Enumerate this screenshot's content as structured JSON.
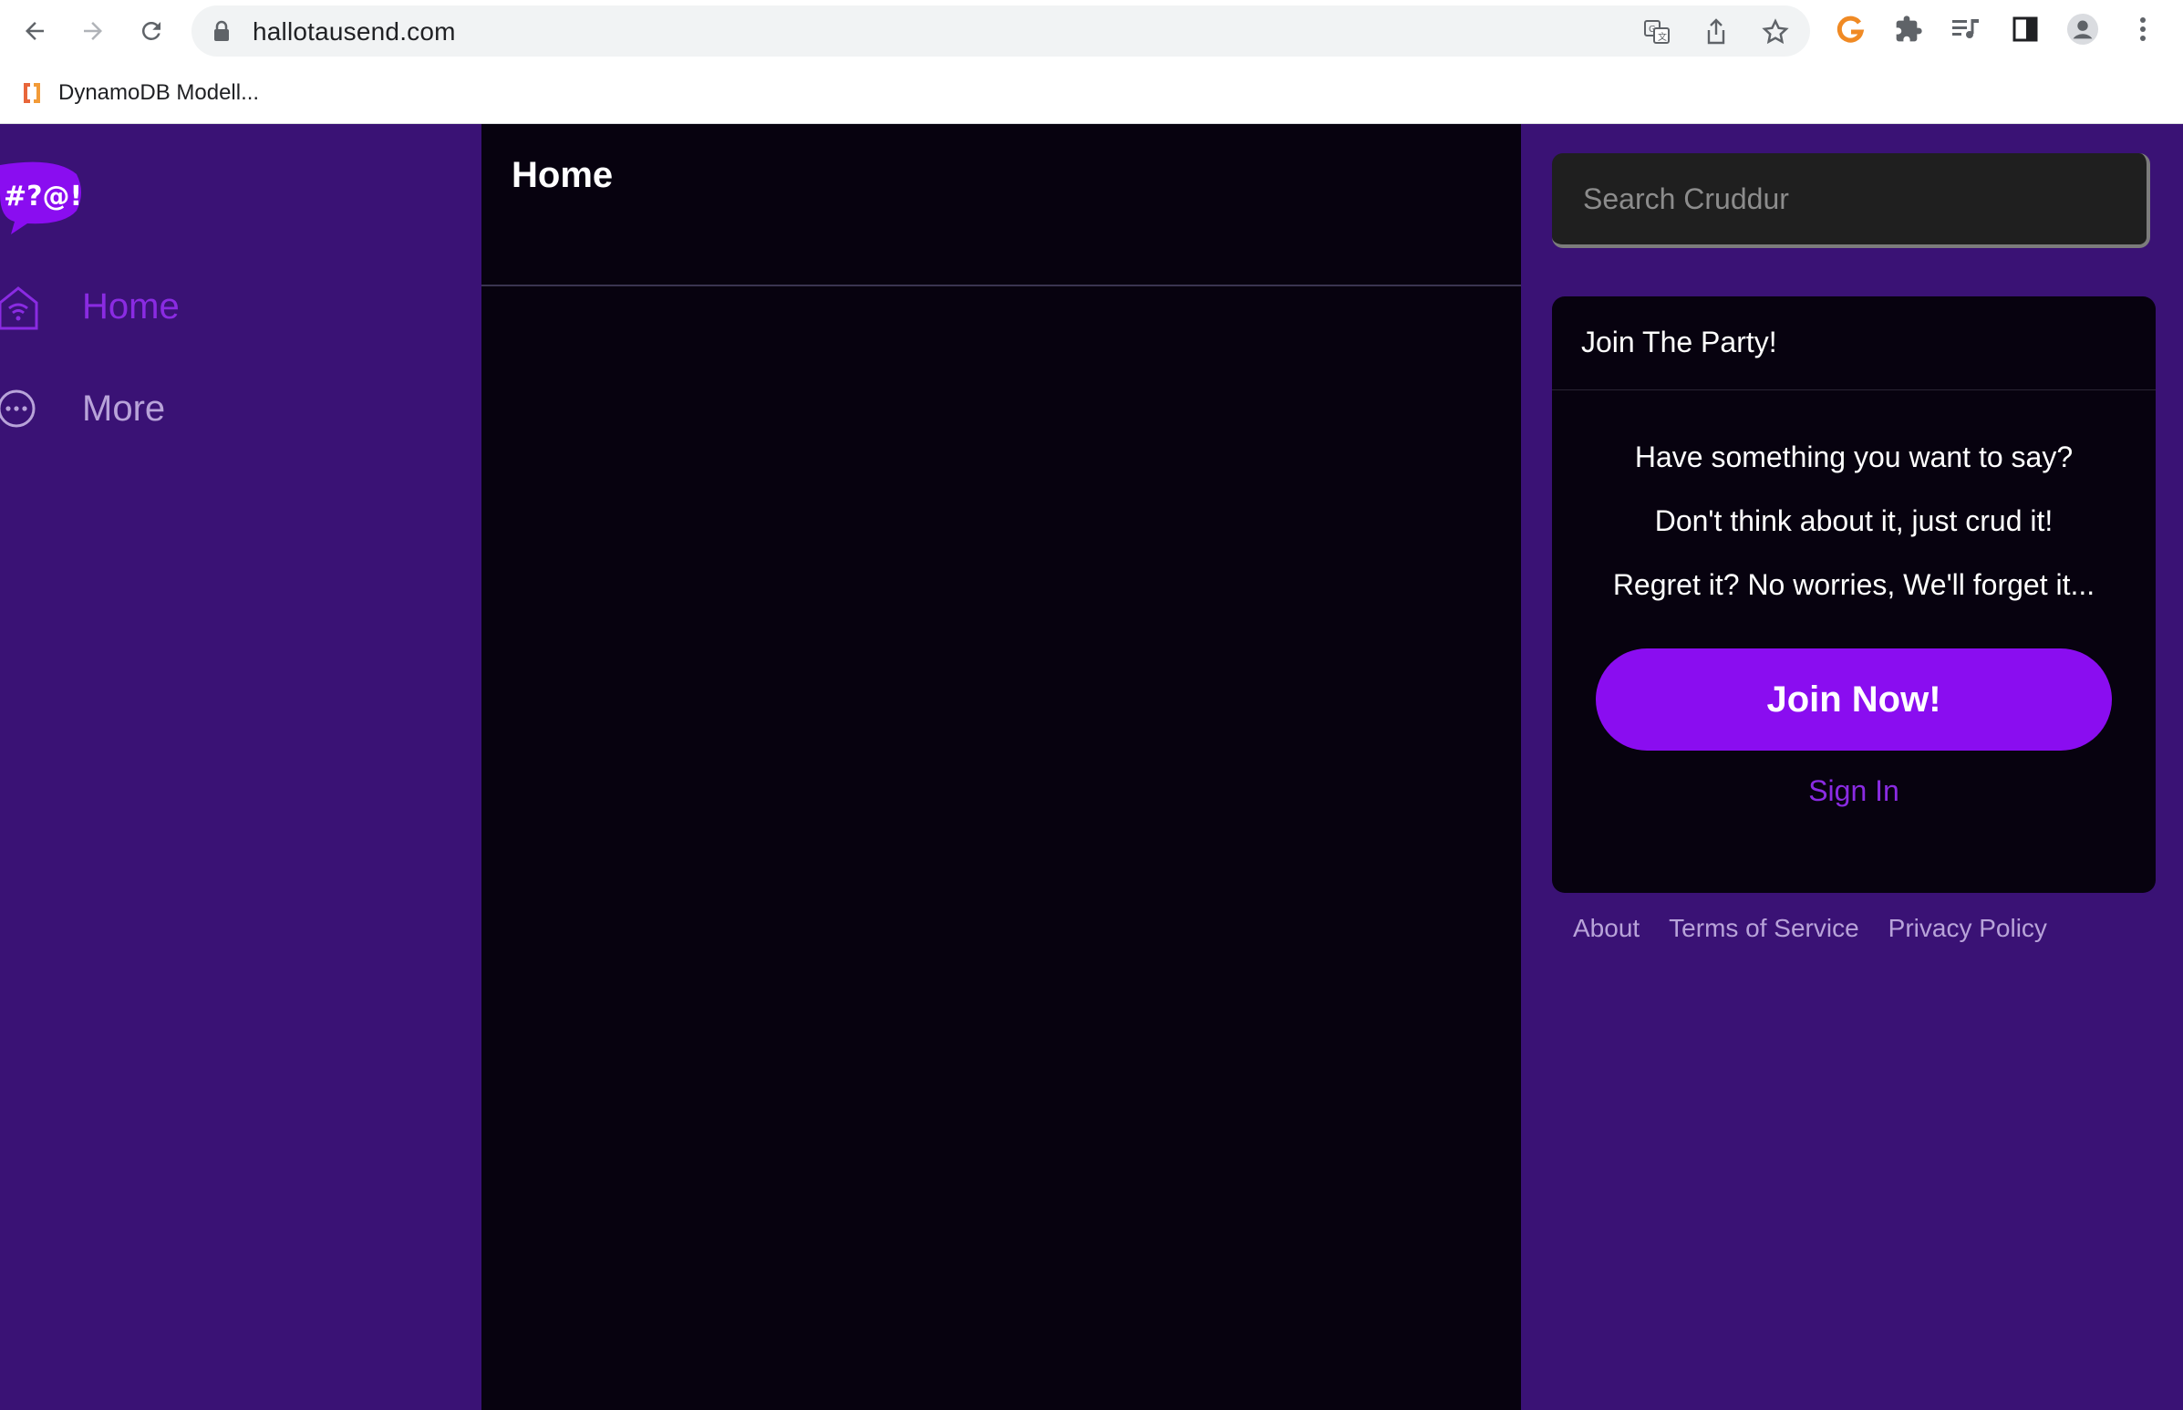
{
  "browser": {
    "url": "hallotausend.com",
    "bookmarks": [
      {
        "label": "DynamoDB Modell..."
      }
    ]
  },
  "sidebar": {
    "logo_text": "#?@!",
    "items": [
      {
        "label": "Home",
        "icon": "home-icon",
        "active": true
      },
      {
        "label": "More",
        "icon": "more-icon",
        "active": false
      }
    ]
  },
  "main": {
    "title": "Home"
  },
  "search": {
    "placeholder": "Search Cruddur"
  },
  "join_card": {
    "title": "Join The Party!",
    "lines": [
      "Have something you want to say?",
      "Don't think about it, just crud it!",
      "Regret it? No worries, We'll forget it..."
    ],
    "join_button": "Join Now!",
    "sign_in": "Sign In"
  },
  "footer": {
    "links": [
      "About",
      "Terms of Service",
      "Privacy Policy"
    ]
  },
  "colors": {
    "sidebar_bg": "#3a1275",
    "main_bg": "#07020f",
    "accent": "#8a0df0",
    "accent_text": "#8a2be2",
    "muted_text": "#b8a3d9"
  }
}
